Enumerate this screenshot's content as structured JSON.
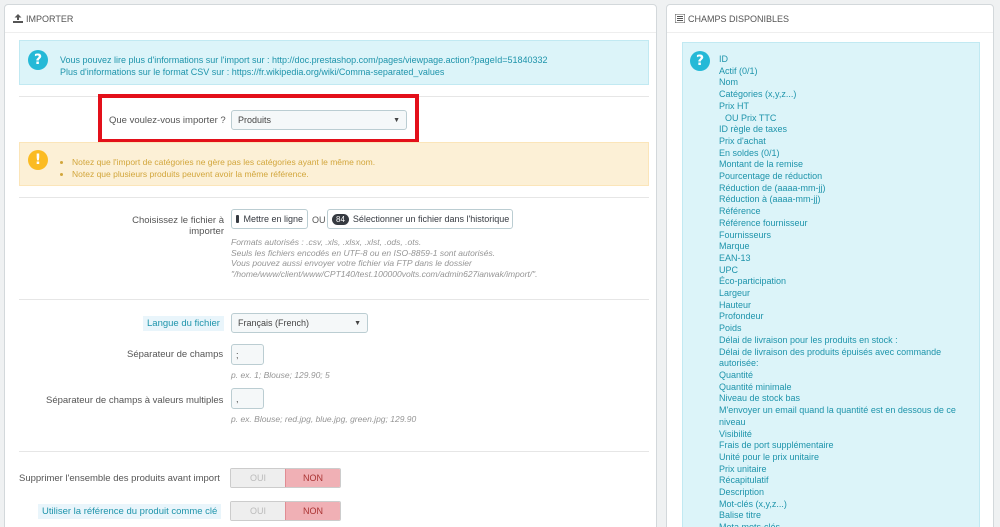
{
  "import_panel": {
    "title": "IMPORTER",
    "info_line1": "Vous pouvez lire plus d'informations sur l'import sur :",
    "info_link1": "http://doc.prestashop.com/pages/viewpage.action?pageId=51840332",
    "info_line2": "Plus d'informations sur le format CSV sur :",
    "info_link2": "https://fr.wikipedia.org/wiki/Comma-separated_values",
    "what_label": "Que voulez-vous importer ?",
    "what_value": "Produits",
    "warnings": [
      "Notez que l'import de catégories ne gère pas les catégories ayant le même nom.",
      "Notez que plusieurs produits peuvent avoir la même référence."
    ],
    "file_label": "Choisissez le fichier à importer",
    "upload_button": "Mettre en ligne",
    "or_text": "OU",
    "history_count": "84",
    "history_button": "Sélectionner un fichier dans l'historique",
    "file_help": [
      "Formats autorisés : .csv, .xls, .xlsx, .xlst, .ods, .ots.",
      "Seuls les fichiers encodés en UTF-8 ou en ISO-8859-1 sont autorisés.",
      "Vous pouvez aussi envoyer votre fichier via FTP dans le dossier",
      "\"/home/www/client/www/CPT140/test.100000volts.com/admin627ianwak/import/\"."
    ],
    "lang_label": "Langue du fichier",
    "lang_value": "Français (French)",
    "sep_label": "Séparateur de champs",
    "sep_value": ";",
    "sep_help": "p. ex. 1; Blouse; 129.90; 5",
    "multi_sep_label": "Séparateur de champs à valeurs multiples",
    "multi_sep_value": ",",
    "multi_sep_help": "p. ex. Blouse; red.jpg, blue.jpg, green.jpg; 129.90",
    "delete_label": "Supprimer l'ensemble des produits avant import",
    "ref_label": "Utiliser la référence du produit comme clé",
    "switch_yes": "OUI",
    "switch_no": "NON"
  },
  "fields_panel": {
    "title": "CHAMPS DISPONIBLES",
    "fields": [
      "ID",
      "Actif (0/1)",
      "Nom",
      "Catégories (x,y,z...)",
      "Prix HT",
      "OU   Prix TTC",
      "ID règle de taxes",
      "Prix d'achat",
      "En soldes (0/1)",
      "Montant de la remise",
      "Pourcentage de réduction",
      "Réduction de (aaaa-mm-jj)",
      "Réduction à (aaaa-mm-jj)",
      "Référence",
      "Référence fournisseur",
      "Fournisseurs",
      "Marque",
      "EAN-13",
      "UPC",
      "Éco-participation",
      "Largeur",
      "Hauteur",
      "Profondeur",
      "Poids",
      "Délai de livraison pour les produits en stock :",
      "Délai de livraison des produits épuisés avec commande",
      "autorisée:",
      "Quantité",
      "Quantité minimale",
      "Niveau de stock bas",
      "M'envoyer un email quand la quantité est en dessous de ce",
      "niveau",
      "Visibilité",
      "Frais de port supplémentaire",
      "Unité pour le prix unitaire",
      "Prix unitaire",
      "Récapitulatif",
      "Description",
      "Mot-clés (x,y,z...)",
      "Balise titre",
      "Meta mots-clés"
    ]
  },
  "colors": {
    "highlight_box": "#e3101a",
    "info_bg": "#dcf4f9",
    "warn_bg": "#fcf0d6"
  }
}
